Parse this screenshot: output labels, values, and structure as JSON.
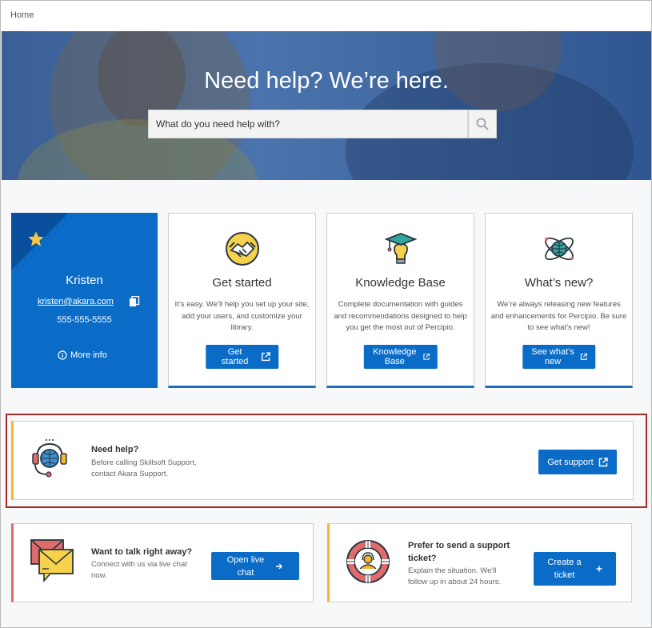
{
  "breadcrumb": "Home",
  "hero": {
    "title": "Need help? We’re here.",
    "search_placeholder": "What do you need help with?"
  },
  "profile": {
    "name": "Kristen",
    "email": "kristen@akara.com",
    "phone": "555-555-5555",
    "more_info": "More info"
  },
  "tiles": [
    {
      "title": "Get started",
      "desc": "It’s easy. We’ll help you set up your site, add your users, and customize your library.",
      "button": "Get started",
      "icon": "handshake-icon"
    },
    {
      "title": "Knowledge Base",
      "desc": "Complete documentation with guides and recommendations designed to help you get the most out of Percipio.",
      "button": "Knowledge Base",
      "icon": "graduation-lightbulb-icon"
    },
    {
      "title": "What’s new?",
      "desc": "We’re always releasing new features and enhancements for Percipio. Be sure to see what’s new!",
      "button": "See what’s new",
      "icon": "atom-globe-icon"
    }
  ],
  "support": {
    "title": "Need help?",
    "desc_line1": "Before calling Skillsoft Support,",
    "desc_line2": "contact Akara Support.",
    "button": "Get support"
  },
  "chat": {
    "title": "Want to talk right away?",
    "desc_line1": "Connect with us via live chat",
    "desc_line2": "now.",
    "button_line1": "Open live",
    "button_line2": "chat"
  },
  "ticket": {
    "title_line1": "Prefer to send a support",
    "title_line2": "ticket?",
    "desc_line1": "Explain the situation. We'll",
    "desc_line2": "follow up in about 24 hours.",
    "button_line1": "Create a",
    "button_line2": "ticket"
  },
  "colors": {
    "primary": "#0a6cc7",
    "accent_yellow": "#f2b630",
    "accent_red": "#e06b6b",
    "highlight": "#a52a2a"
  }
}
